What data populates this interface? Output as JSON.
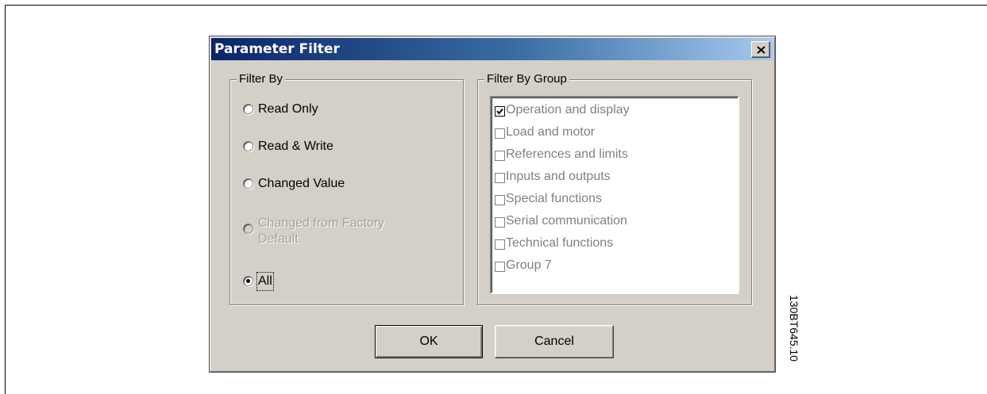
{
  "dialog": {
    "title": "Parameter Filter",
    "close_icon": "close-icon"
  },
  "filter_by": {
    "label": "Filter By",
    "options": [
      {
        "label": "Read Only",
        "selected": false,
        "enabled": true
      },
      {
        "label": "Read & Write",
        "selected": false,
        "enabled": true
      },
      {
        "label": "Changed Value",
        "selected": false,
        "enabled": true
      },
      {
        "label": "Changed from Factory Default",
        "selected": false,
        "enabled": false
      },
      {
        "label": "All",
        "selected": true,
        "enabled": true
      }
    ]
  },
  "filter_by_group": {
    "label": "Filter By Group",
    "items": [
      {
        "label": "Operation and display",
        "checked": true
      },
      {
        "label": "Load and motor",
        "checked": false
      },
      {
        "label": "References and limits",
        "checked": false
      },
      {
        "label": "Inputs and outputs",
        "checked": false
      },
      {
        "label": "Special functions",
        "checked": false
      },
      {
        "label": "Serial communication",
        "checked": false
      },
      {
        "label": "Technical functions",
        "checked": false
      },
      {
        "label": "Group 7",
        "checked": false
      }
    ]
  },
  "buttons": {
    "ok_label": "OK",
    "cancel_label": "Cancel"
  },
  "figure_code": "130BT645.10",
  "colors": {
    "dialog_face": "#d4d0c8",
    "titlebar_start": "#0a246a",
    "titlebar_end": "#a6caf0",
    "disabled_text": "#a0a0a0",
    "list_text": "#808080"
  }
}
